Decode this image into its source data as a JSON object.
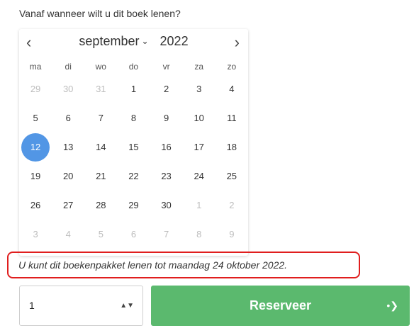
{
  "question": "Vanaf wanneer wilt u dit boek lenen?",
  "calendar": {
    "month": "september",
    "year": "2022",
    "weekdays": [
      "ma",
      "di",
      "wo",
      "do",
      "vr",
      "za",
      "zo"
    ],
    "weeks": [
      [
        "29",
        "30",
        "31",
        "1",
        "2",
        "3",
        "4"
      ],
      [
        "5",
        "6",
        "7",
        "8",
        "9",
        "10",
        "11"
      ],
      [
        "12",
        "13",
        "14",
        "15",
        "16",
        "17",
        "18"
      ],
      [
        "19",
        "20",
        "21",
        "22",
        "23",
        "24",
        "25"
      ],
      [
        "26",
        "27",
        "28",
        "29",
        "30",
        "1",
        "2"
      ],
      [
        "3",
        "4",
        "5",
        "6",
        "7",
        "8",
        "9"
      ]
    ],
    "selected": "12",
    "prev_icon": "chevron-left-icon",
    "next_icon": "chevron-right-icon"
  },
  "notice": "U kunt dit boekenpakket lenen tot maandag 24 oktober 2022.",
  "quantity": {
    "value": "1"
  },
  "reserve": {
    "label": "Reserveer",
    "icon": "arrow-right-icon"
  },
  "colors": {
    "selected": "#5296e5",
    "button": "#5bb96e",
    "notice_border": "#e01e1e"
  }
}
